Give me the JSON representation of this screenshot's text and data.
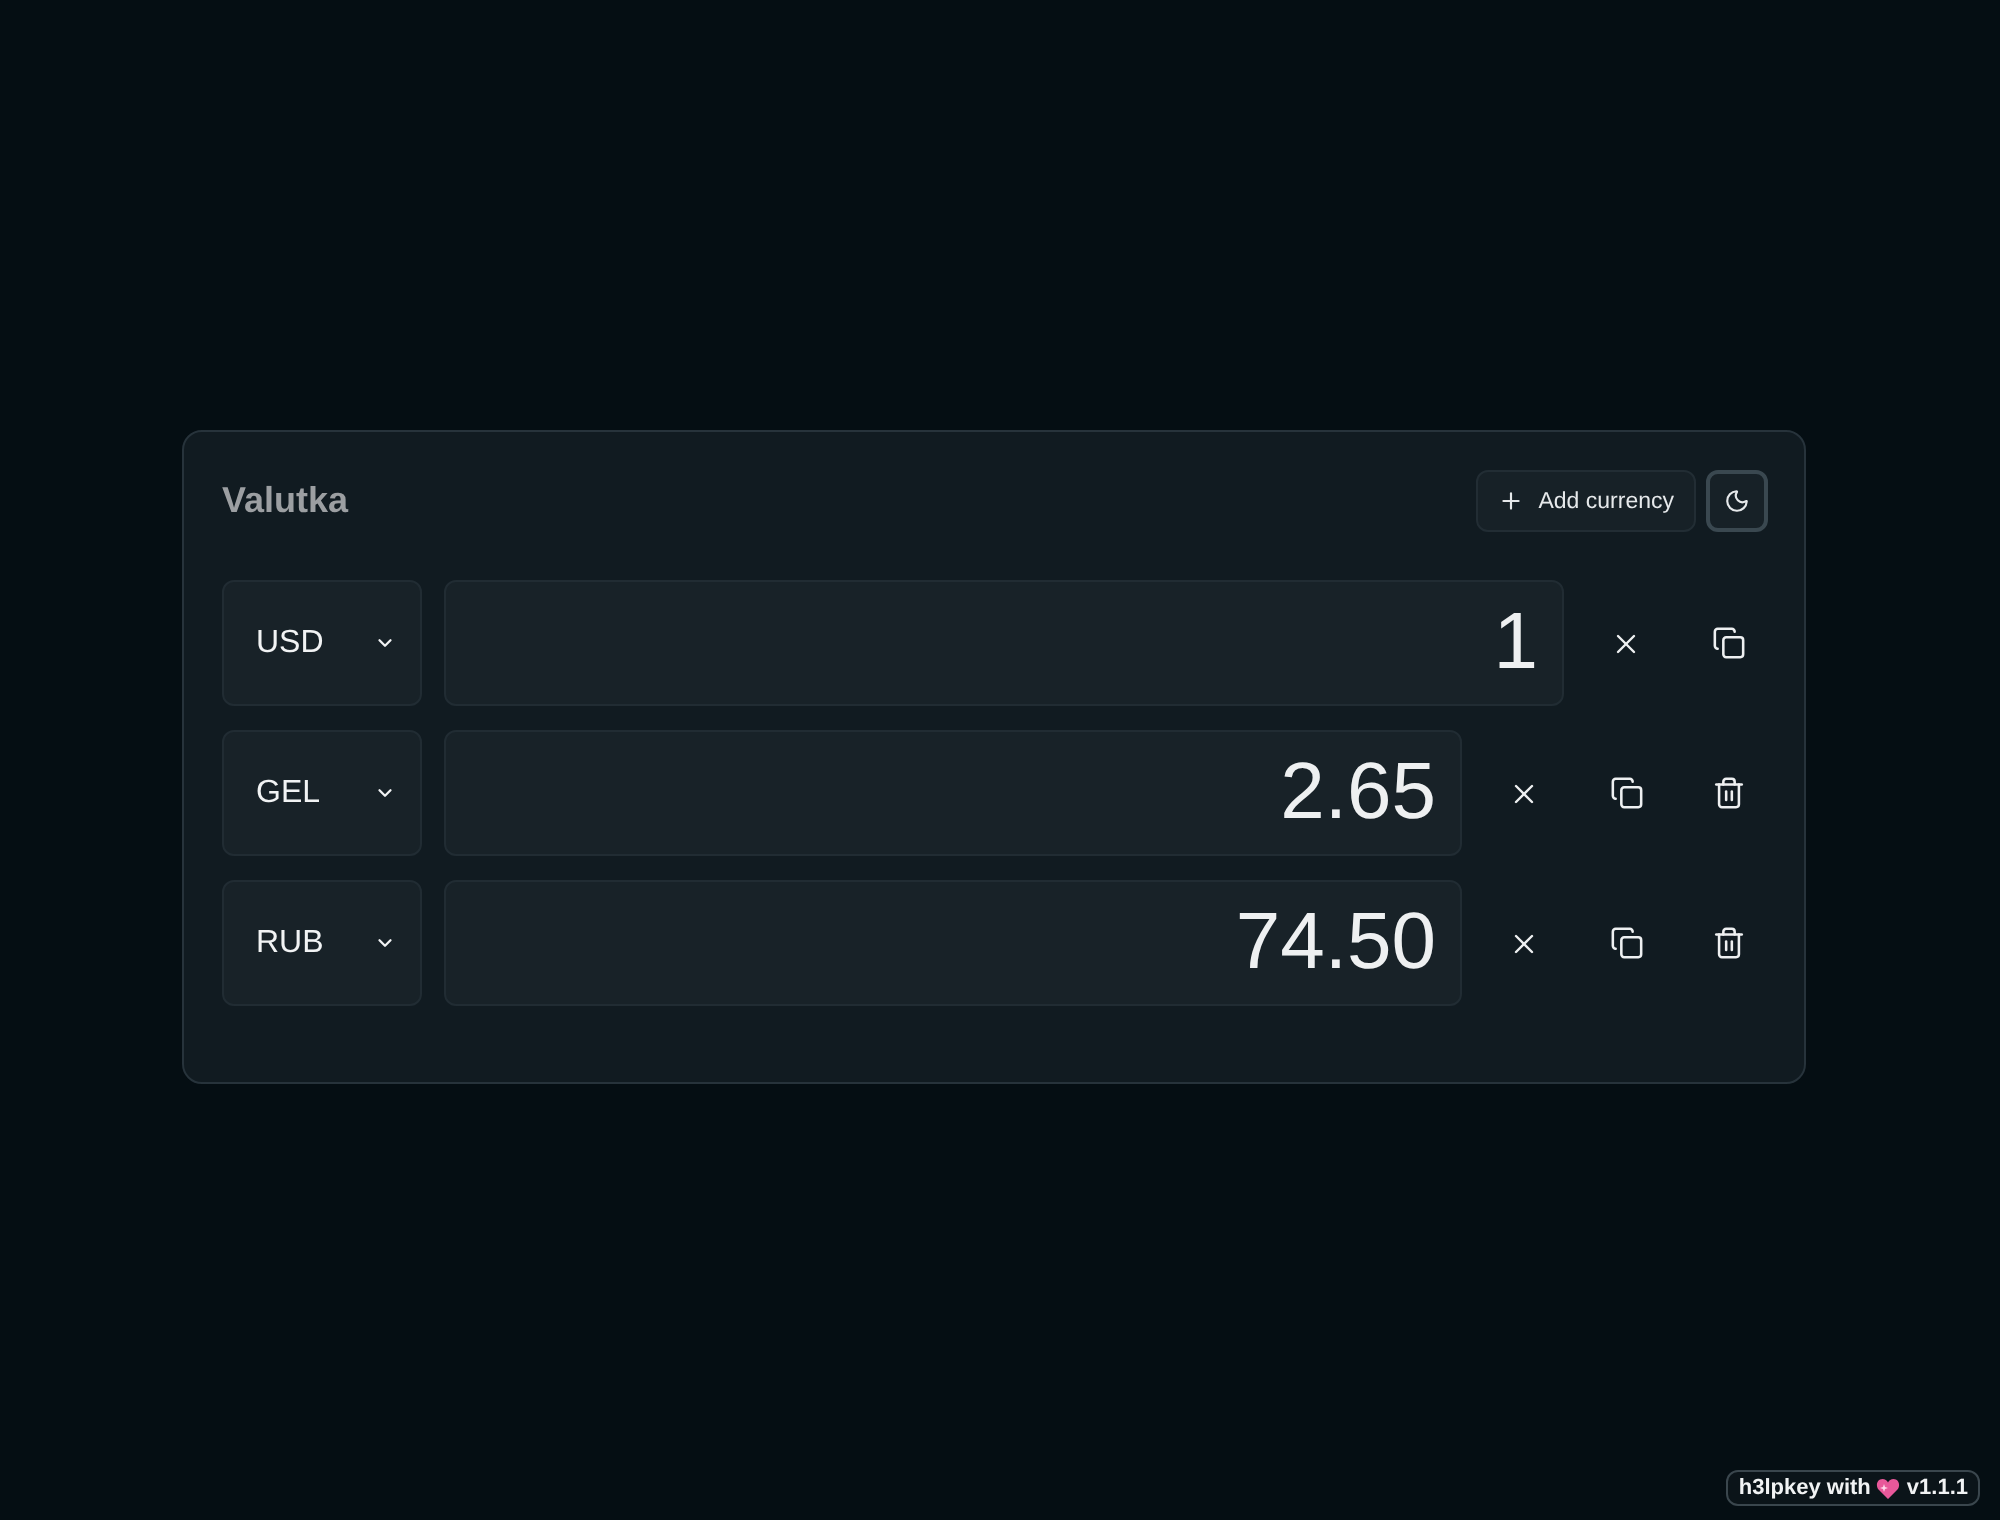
{
  "app": {
    "title": "Valutka"
  },
  "header": {
    "add_button": {
      "label": "Add currency"
    },
    "theme_toggle": {
      "focused": true
    }
  },
  "rows": [
    {
      "currency": "USD",
      "value": "1",
      "removable": false
    },
    {
      "currency": "GEL",
      "value": "2.65",
      "removable": true
    },
    {
      "currency": "RUB",
      "value": "74.50",
      "removable": true
    }
  ],
  "footer_badge": {
    "text_before": "h3lpkey with",
    "text_after": "v1.1.1"
  }
}
